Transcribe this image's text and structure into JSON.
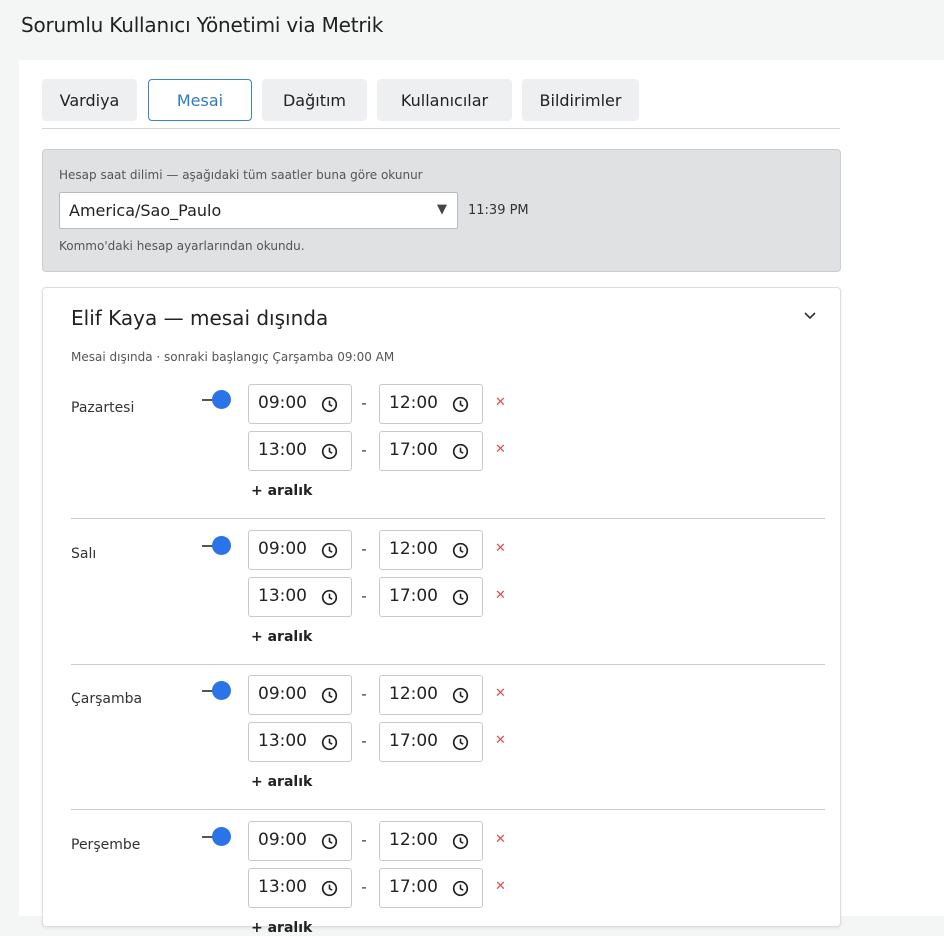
{
  "page_title": "Sorumlu Kullanıcı Yönetimi via Metrik",
  "tabs": [
    {
      "label": "Vardiya",
      "active": false
    },
    {
      "label": "Mesai",
      "active": true
    },
    {
      "label": "Dağıtım",
      "active": false
    },
    {
      "label": "Kullanıcılar",
      "active": false
    },
    {
      "label": "Bildirimler",
      "active": false
    }
  ],
  "timezone": {
    "hint": "Hesap saat dilimi — aşağıdaki tüm saatler buna göre okunur",
    "selected": "America/Sao_Paulo",
    "current_time": "11:39 PM",
    "note": "Kommo'daki hesap ayarlarından okundu."
  },
  "user": {
    "title": "Elif Kaya — mesai dışında",
    "status": "Mesai dışında · sonraki başlangıç Çarşamba 09:00 AM",
    "add_range_label": "+ aralık",
    "days": [
      {
        "name": "Pazartesi",
        "enabled": true,
        "ranges": [
          {
            "start": "09:00",
            "end": "12:00"
          },
          {
            "start": "13:00",
            "end": "17:00"
          }
        ]
      },
      {
        "name": "Salı",
        "enabled": true,
        "ranges": [
          {
            "start": "09:00",
            "end": "12:00"
          },
          {
            "start": "13:00",
            "end": "17:00"
          }
        ]
      },
      {
        "name": "Çarşamba",
        "enabled": true,
        "ranges": [
          {
            "start": "09:00",
            "end": "12:00"
          },
          {
            "start": "13:00",
            "end": "17:00"
          }
        ]
      },
      {
        "name": "Perşembe",
        "enabled": true,
        "ranges": [
          {
            "start": "09:00",
            "end": "12:00"
          },
          {
            "start": "13:00",
            "end": "17:00"
          }
        ]
      }
    ]
  },
  "icons": {
    "collapse": "chevron-down-icon",
    "time": "clock-icon",
    "remove": "close-icon",
    "select": "caret-down-icon"
  },
  "colors": {
    "accent": "#2f7ac4",
    "toggle_on": "#2b73e8",
    "remove": "#e0514a"
  }
}
